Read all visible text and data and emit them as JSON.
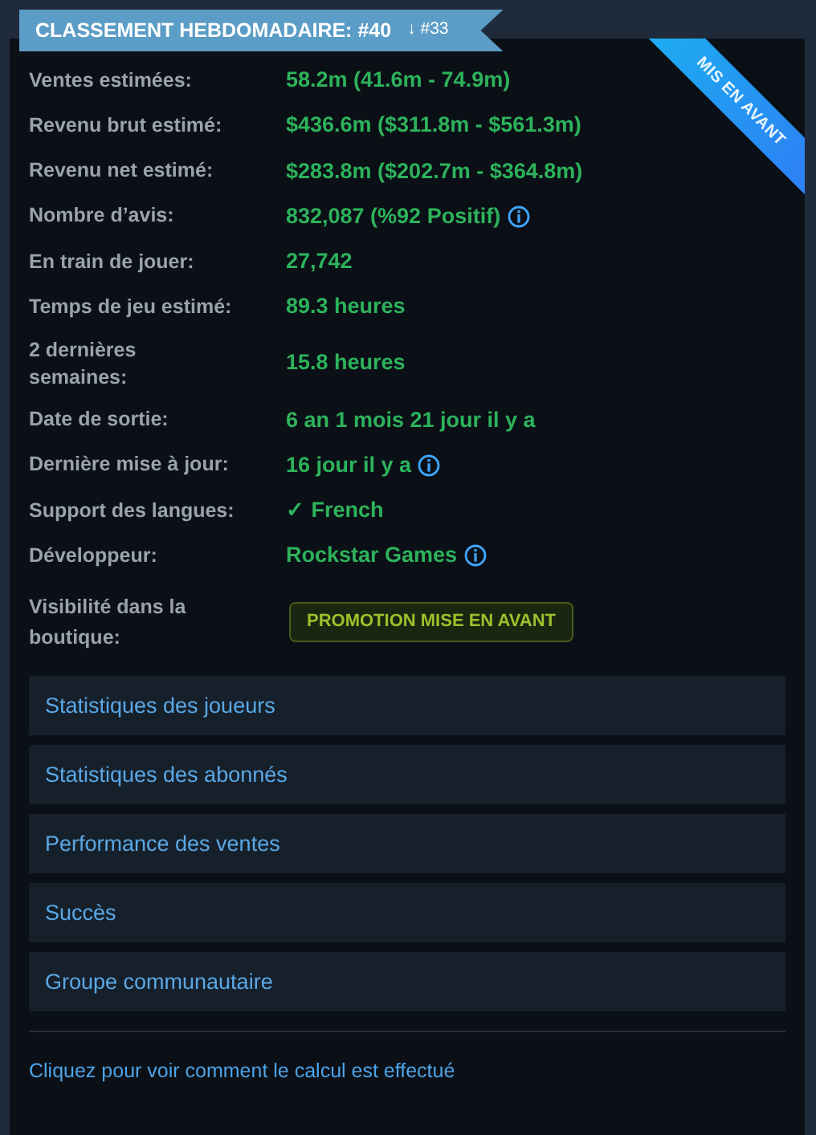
{
  "rank_ribbon": {
    "title": "CLASSEMENT HEBDOMADAIRE: #40",
    "change": "↓ #33"
  },
  "corner_ribbon": "MIS EN AVANT",
  "stats": [
    {
      "kind": "text",
      "label": "Ventes estimées:",
      "value": "58.2m (41.6m - 74.9m)",
      "info": false
    },
    {
      "kind": "text",
      "label": "Revenu brut estimé:",
      "value": "$436.6m ($311.8m - $561.3m)",
      "info": false
    },
    {
      "kind": "text",
      "label": "Revenu net estimé:",
      "value": "$283.8m ($202.7m - $364.8m)",
      "info": false
    },
    {
      "kind": "text",
      "label": "Nombre d’avis:",
      "value": "832,087 (%92 Positif)",
      "info": true
    },
    {
      "kind": "text",
      "label": "En train de jouer:",
      "value": "27,742",
      "info": false
    },
    {
      "kind": "text",
      "label": "Temps de jeu estimé:",
      "value": "89.3 heures",
      "info": false
    },
    {
      "kind": "text",
      "label": "2 dernières semaines:",
      "value": "15.8 heures",
      "info": false
    },
    {
      "kind": "text",
      "label": "Date de sortie:",
      "value": "6 an 1 mois 21 jour il y a",
      "info": false
    },
    {
      "kind": "text",
      "label": "Dernière mise à jour:",
      "value": "16 jour il y a",
      "info": true
    },
    {
      "kind": "text",
      "label": "Support des langues:",
      "value": "✓ French",
      "info": false
    },
    {
      "kind": "text",
      "label": "Développeur:",
      "value": "Rockstar Games",
      "info": true
    },
    {
      "kind": "badge",
      "label": "Visibilité dans la boutique:",
      "value": "PROMOTION MISE EN AVANT",
      "info": false
    }
  ],
  "links": [
    "Statistiques des joueurs",
    "Statistiques des abonnés",
    "Performance des ventes",
    "Succès",
    "Groupe communautaire"
  ],
  "footer_link": "Cliquez pour voir comment le calcul est effectué"
}
